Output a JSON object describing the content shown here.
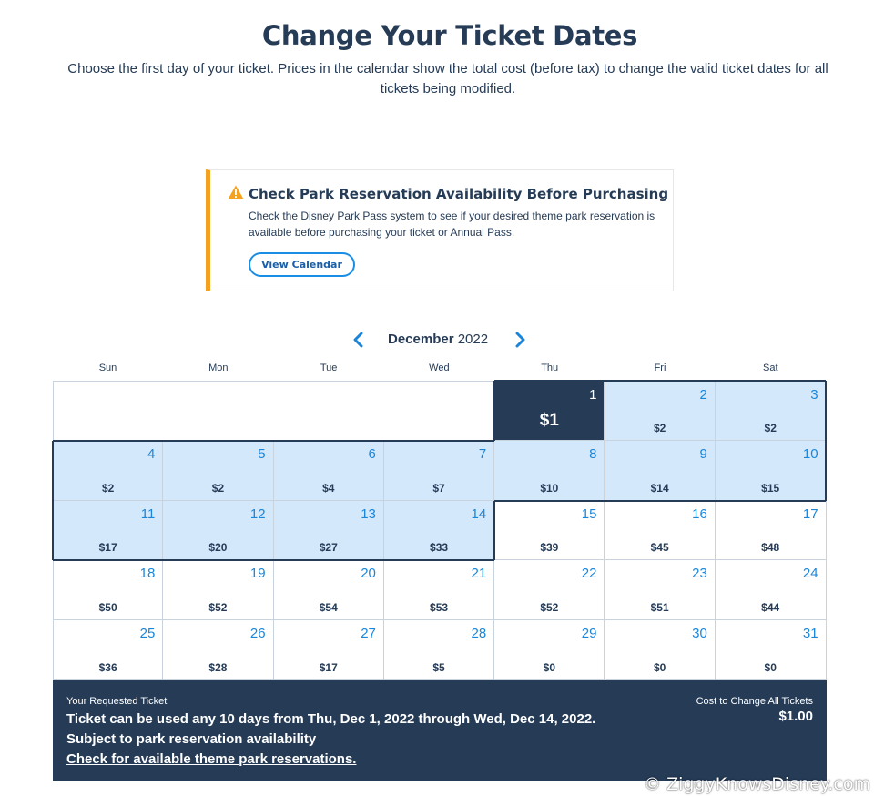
{
  "header": {
    "title": "Change Your Ticket Dates",
    "subtitle": "Choose the first day of your ticket. Prices in the calendar show the total cost (before tax) to change the valid ticket dates for all tickets being modified."
  },
  "alert": {
    "icon": "warning-icon",
    "title": "Check Park Reservation Availability Before Purchasing",
    "body": "Check the Disney Park Pass system to see if your desired theme park reservation is available before purchasing your ticket or Annual Pass.",
    "button_label": "View Calendar",
    "accent_color": "#f4a11f"
  },
  "calendar": {
    "month": "December",
    "year": "2022",
    "prev_icon": "chevron-left-icon",
    "next_icon": "chevron-right-icon",
    "weekdays": [
      "Sun",
      "Mon",
      "Tue",
      "Wed",
      "Thu",
      "Fri",
      "Sat"
    ],
    "first_weekday_index": 4,
    "selected_day": 1,
    "highlight_range": [
      1,
      14
    ],
    "days": [
      {
        "day": "1",
        "price": "$1"
      },
      {
        "day": "2",
        "price": "$2"
      },
      {
        "day": "3",
        "price": "$2"
      },
      {
        "day": "4",
        "price": "$2"
      },
      {
        "day": "5",
        "price": "$2"
      },
      {
        "day": "6",
        "price": "$4"
      },
      {
        "day": "7",
        "price": "$7"
      },
      {
        "day": "8",
        "price": "$10"
      },
      {
        "day": "9",
        "price": "$14"
      },
      {
        "day": "10",
        "price": "$15"
      },
      {
        "day": "11",
        "price": "$17"
      },
      {
        "day": "12",
        "price": "$20"
      },
      {
        "day": "13",
        "price": "$27"
      },
      {
        "day": "14",
        "price": "$33"
      },
      {
        "day": "15",
        "price": "$39"
      },
      {
        "day": "16",
        "price": "$45"
      },
      {
        "day": "17",
        "price": "$48"
      },
      {
        "day": "18",
        "price": "$50"
      },
      {
        "day": "19",
        "price": "$52"
      },
      {
        "day": "20",
        "price": "$54"
      },
      {
        "day": "21",
        "price": "$53"
      },
      {
        "day": "22",
        "price": "$52"
      },
      {
        "day": "23",
        "price": "$51"
      },
      {
        "day": "24",
        "price": "$44"
      },
      {
        "day": "25",
        "price": "$36"
      },
      {
        "day": "26",
        "price": "$28"
      },
      {
        "day": "27",
        "price": "$17"
      },
      {
        "day": "28",
        "price": "$5"
      },
      {
        "day": "29",
        "price": "$0"
      },
      {
        "day": "30",
        "price": "$0"
      },
      {
        "day": "31",
        "price": "$0"
      }
    ],
    "colors": {
      "selected": "#253b56",
      "highlight": "#d4e8fb",
      "day_number": "#1a86d9"
    }
  },
  "summary": {
    "label": "Your Requested Ticket",
    "line1": "Ticket can be used any 10 days from Thu, Dec 1, 2022 through Wed, Dec 14, 2022.",
    "line2": "Subject to park reservation availability",
    "link": "Check for available theme park reservations.",
    "cost_label": "Cost to Change All Tickets",
    "cost_value": "$1.00"
  },
  "watermark": "© ZiggyKnowsDisney.com"
}
